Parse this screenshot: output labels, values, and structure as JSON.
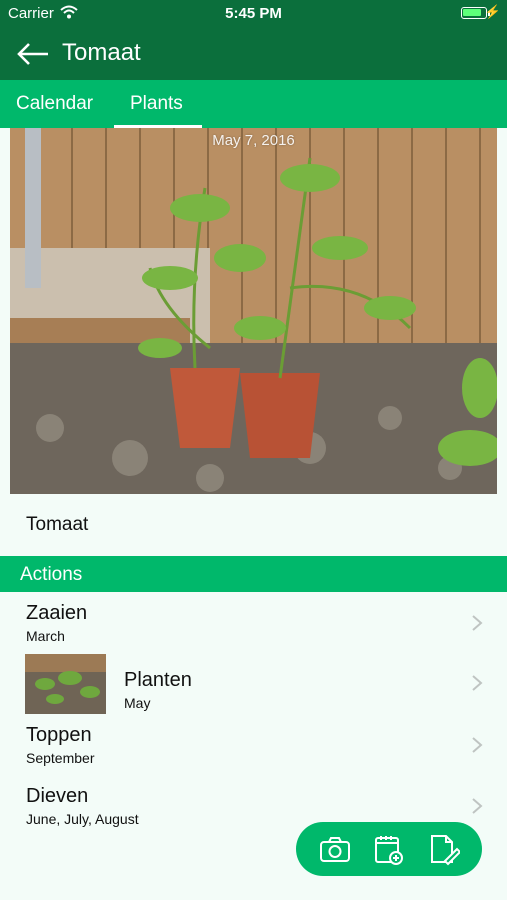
{
  "status_bar": {
    "carrier": "Carrier",
    "time": "5:45 PM"
  },
  "app_bar": {
    "title": "Tomaat"
  },
  "tabs": [
    {
      "label": "Calendar"
    },
    {
      "label": "Plants"
    }
  ],
  "photo": {
    "date": "May 7, 2016"
  },
  "plant": {
    "name": "Tomaat"
  },
  "actions_section": {
    "label": "Actions"
  },
  "actions": [
    {
      "title": "Zaaien",
      "subtitle": "March"
    },
    {
      "title": "Planten",
      "subtitle": "May"
    },
    {
      "title": "Toppen",
      "subtitle": "September"
    },
    {
      "title": "Dieven",
      "subtitle": "June, July, August"
    }
  ],
  "fab": {
    "items": [
      "camera-icon",
      "calendar-add-icon",
      "edit-note-icon"
    ]
  },
  "colors": {
    "primary_dark": "#0b6f3c",
    "primary": "#00b86b",
    "background": "#f3fcf8"
  }
}
